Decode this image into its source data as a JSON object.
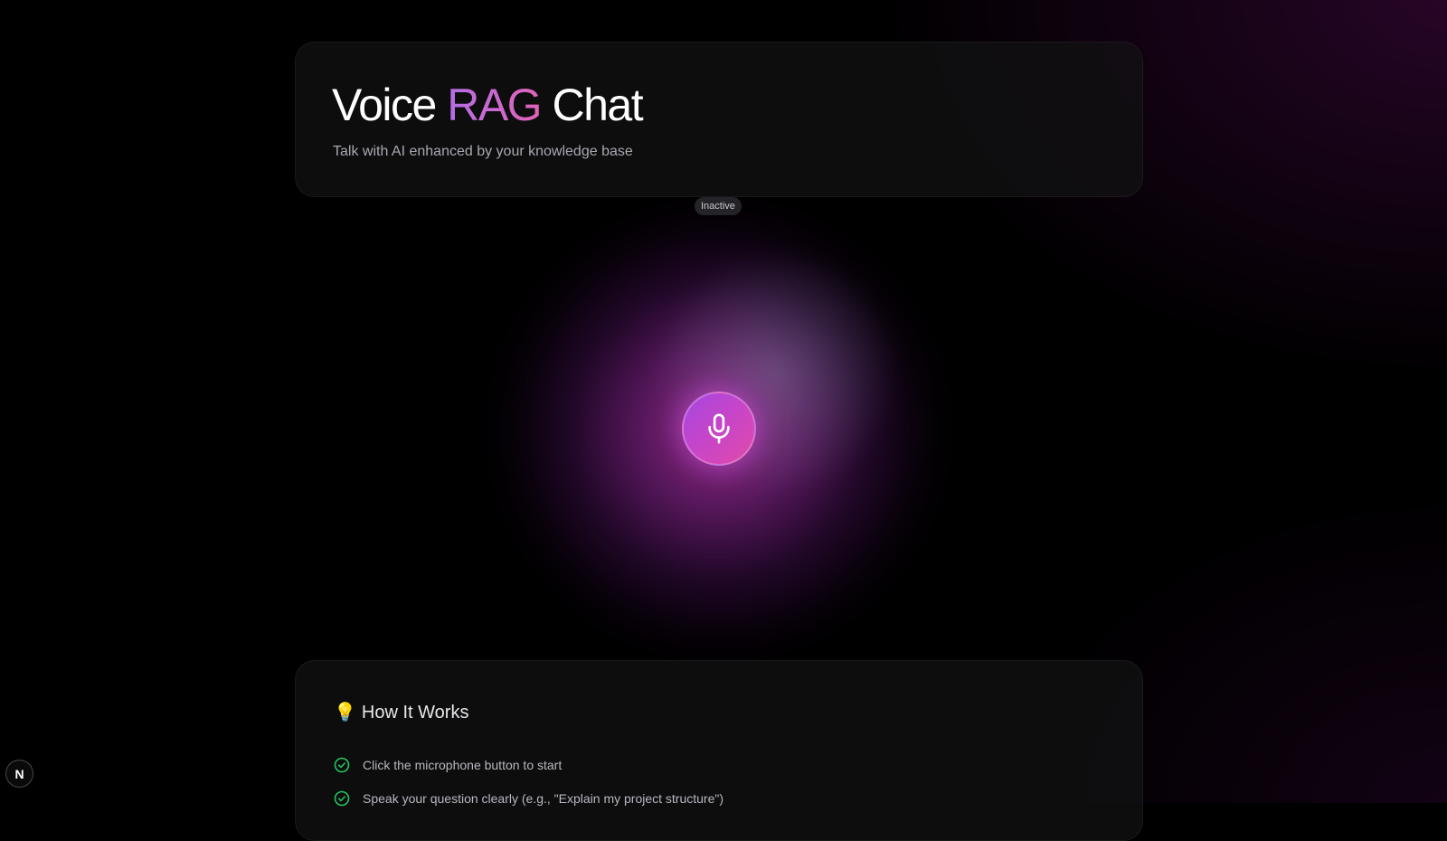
{
  "header": {
    "title_part1": "Voice ",
    "title_accent": "RAG",
    "title_part2": " Chat",
    "subtitle": "Talk with AI enhanced by your knowledge base"
  },
  "status": {
    "label": "Inactive"
  },
  "mic": {
    "icon": "microphone-icon",
    "accent_from": "#a447e0",
    "accent_to": "#e04aa8"
  },
  "how_it_works": {
    "icon": "lightbulb-icon",
    "title": "How It Works",
    "steps": [
      "Click the microphone button to start",
      "Speak your question clearly (e.g., \"Explain my project structure\")"
    ],
    "check_color": "#22c55e"
  },
  "dev_badge": {
    "label": "N"
  }
}
